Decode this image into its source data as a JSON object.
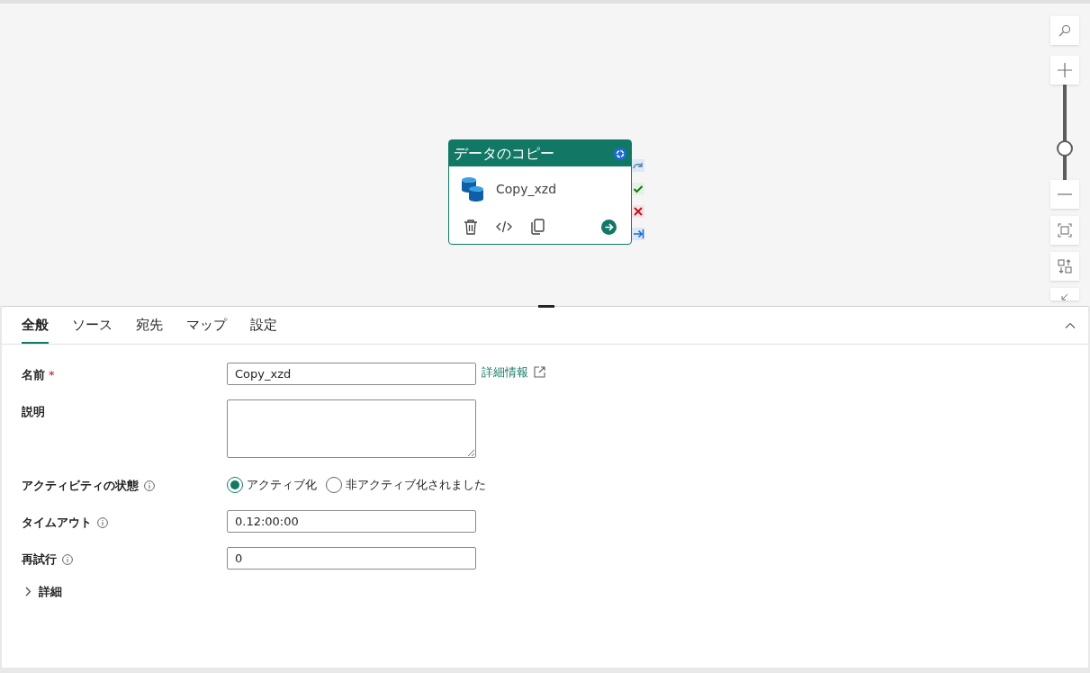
{
  "canvas": {
    "activity": {
      "type_label": "データのコピー",
      "name": "Copy_xzd"
    },
    "zoom": {
      "level": 0.33
    }
  },
  "tabs": [
    {
      "label": "全般",
      "selected": true
    },
    {
      "label": "ソース",
      "selected": false
    },
    {
      "label": "宛先",
      "selected": false
    },
    {
      "label": "マップ",
      "selected": false
    },
    {
      "label": "設定",
      "selected": false
    }
  ],
  "form": {
    "name": {
      "label": "名前",
      "required_mark": "*",
      "value": "Copy_xzd",
      "link": "詳細情報"
    },
    "description": {
      "label": "説明"
    },
    "state": {
      "label": "アクティビティの状態",
      "options": [
        {
          "label": "アクティブ化",
          "selected": true
        },
        {
          "label": "非アクティブ化されました",
          "selected": false
        }
      ]
    },
    "timeout": {
      "label": "タイムアウト",
      "value": "0.12:00:00"
    },
    "retry": {
      "label": "再試行",
      "value": "0"
    },
    "advanced": {
      "label": "詳細",
      "expanded": false
    }
  }
}
